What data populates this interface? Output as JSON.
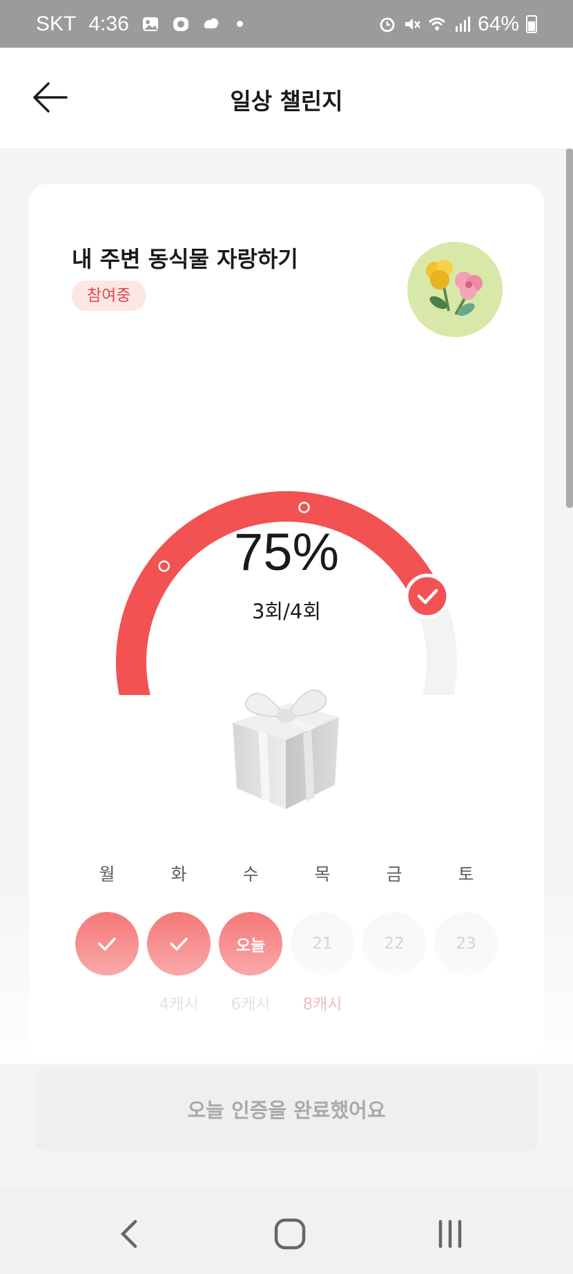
{
  "status_bar": {
    "carrier": "SKT",
    "time": "4:36",
    "battery": "64%",
    "icons_left": [
      "gallery-icon",
      "app-icon",
      "cloud-icon",
      "dot-icon"
    ],
    "icons_right": [
      "alarm-icon",
      "mute-icon",
      "wifi-icon",
      "signal-icon",
      "battery-icon"
    ]
  },
  "header": {
    "title": "일상 챌린지",
    "back_icon": "arrow-left-icon"
  },
  "challenge": {
    "title": "내 주변 동식물 자랑하기",
    "status": "참여중",
    "thumbnail_icon": "flowers-icon"
  },
  "progress": {
    "percent_label": "75%",
    "count_label": "3회/4회",
    "completed": 3,
    "total": 4,
    "fraction": 0.75,
    "colors": {
      "active": "#f25252",
      "track": "#f3f3f3"
    }
  },
  "reward_icon": "gift-box-icon",
  "week": [
    {
      "day": "월",
      "state": "done",
      "text": "",
      "reward": ""
    },
    {
      "day": "화",
      "state": "done",
      "text": "",
      "reward": "4캐시"
    },
    {
      "day": "수",
      "state": "today",
      "text": "오늘",
      "reward": "6캐시"
    },
    {
      "day": "목",
      "state": "future",
      "text": "21",
      "reward": "8캐시",
      "reward_highlight": true
    },
    {
      "day": "금",
      "state": "future",
      "text": "22",
      "reward": ""
    },
    {
      "day": "토",
      "state": "future",
      "text": "23",
      "reward": ""
    }
  ],
  "action_button": {
    "label": "오늘 인증을 완료했어요",
    "disabled": true
  },
  "nav_bar": {
    "icons": [
      "back-nav-icon",
      "home-nav-icon",
      "recents-nav-icon"
    ]
  }
}
